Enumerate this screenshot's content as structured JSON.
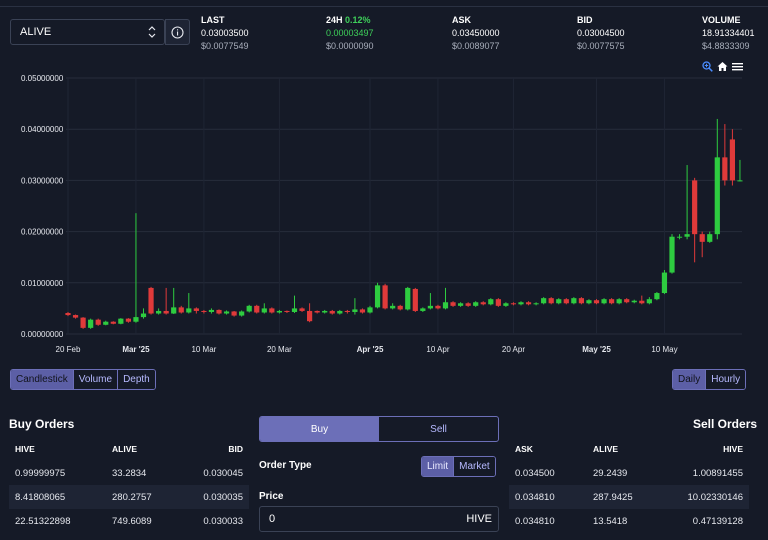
{
  "token": {
    "symbol": "ALIVE"
  },
  "stats": [
    {
      "label": "LAST",
      "pct": "",
      "value": "0.03003500",
      "usd": "$0.0077549"
    },
    {
      "label": "24H",
      "pct": "0.12%",
      "value": "0.00003497",
      "usd": "$0.0000090"
    },
    {
      "label": "ASK",
      "pct": "",
      "value": "0.03450000",
      "usd": "$0.0089077"
    },
    {
      "label": "BID",
      "pct": "",
      "value": "0.03004500",
      "usd": "$0.0077575"
    },
    {
      "label": "VOLUME",
      "pct": "",
      "value": "18.91334401",
      "usd": "$4.8833309"
    }
  ],
  "chart_toolbar": {
    "zoom": "zoom-in-icon",
    "home": "home-icon",
    "menu": "menu-icon"
  },
  "chart_data": {
    "type": "candlestick",
    "y_ticks": [
      "0.05000000",
      "0.04000000",
      "0.03000000",
      "0.02000000",
      "0.01000000",
      "0.00000000"
    ],
    "ylim": [
      0,
      0.05
    ],
    "x_ticks": [
      "20 Feb",
      "Mar '25",
      "10 Mar",
      "20 Mar",
      "Apr '25",
      "10 Apr",
      "20 Apr",
      "May '25",
      "10 May"
    ],
    "x_tick_bold": [
      false,
      true,
      false,
      false,
      true,
      false,
      false,
      true,
      false
    ],
    "x_tick_days": [
      0,
      9,
      18,
      28,
      40,
      49,
      59,
      70,
      79
    ],
    "colors": {
      "up": "#2ecc40",
      "down": "#e03a3a"
    },
    "candles": [
      [
        0,
        0.0041,
        0.0037,
        0.0043,
        0.0035
      ],
      [
        1,
        0.0037,
        0.0032,
        0.0038,
        0.003
      ],
      [
        2,
        0.0032,
        0.0012,
        0.0033,
        0.001
      ],
      [
        3,
        0.0012,
        0.0028,
        0.003,
        0.001
      ],
      [
        4,
        0.0028,
        0.0018,
        0.003,
        0.0016
      ],
      [
        5,
        0.0018,
        0.0024,
        0.0026,
        0.0017
      ],
      [
        6,
        0.0024,
        0.002,
        0.0025,
        0.0019
      ],
      [
        7,
        0.002,
        0.003,
        0.0031,
        0.0019
      ],
      [
        8,
        0.003,
        0.0024,
        0.0031,
        0.0022
      ],
      [
        9,
        0.0024,
        0.0033,
        0.0236,
        0.0022
      ],
      [
        10,
        0.0033,
        0.004,
        0.005,
        0.003
      ],
      [
        11,
        0.009,
        0.004,
        0.0092,
        0.0038
      ],
      [
        12,
        0.004,
        0.0045,
        0.005,
        0.0038
      ],
      [
        13,
        0.0045,
        0.004,
        0.009,
        0.0038
      ],
      [
        14,
        0.004,
        0.0052,
        0.009,
        0.0039
      ],
      [
        15,
        0.0052,
        0.0042,
        0.0055,
        0.004
      ],
      [
        16,
        0.0042,
        0.005,
        0.008,
        0.004
      ],
      [
        17,
        0.005,
        0.0045,
        0.0052,
        0.004
      ],
      [
        18,
        0.0045,
        0.0043,
        0.0047,
        0.004
      ],
      [
        19,
        0.0043,
        0.0047,
        0.005,
        0.004
      ],
      [
        20,
        0.0047,
        0.004,
        0.0048,
        0.0038
      ],
      [
        21,
        0.004,
        0.0044,
        0.0046,
        0.0038
      ],
      [
        22,
        0.0044,
        0.0036,
        0.0045,
        0.0034
      ],
      [
        23,
        0.0036,
        0.0044,
        0.0046,
        0.0034
      ],
      [
        24,
        0.0044,
        0.0055,
        0.0057,
        0.0042
      ],
      [
        25,
        0.0055,
        0.0042,
        0.0057,
        0.004
      ],
      [
        26,
        0.0042,
        0.005,
        0.006,
        0.004
      ],
      [
        27,
        0.005,
        0.0042,
        0.0052,
        0.004
      ],
      [
        28,
        0.0042,
        0.0045,
        0.0047,
        0.004
      ],
      [
        29,
        0.0045,
        0.0043,
        0.0046,
        0.0041
      ],
      [
        30,
        0.0043,
        0.005,
        0.0075,
        0.0041
      ],
      [
        31,
        0.005,
        0.0045,
        0.0052,
        0.0043
      ],
      [
        32,
        0.0045,
        0.0025,
        0.006,
        0.0023
      ],
      [
        33,
        0.0045,
        0.0042,
        0.0046,
        0.004
      ],
      [
        34,
        0.0042,
        0.0045,
        0.0047,
        0.004
      ],
      [
        35,
        0.0045,
        0.004,
        0.0047,
        0.0038
      ],
      [
        36,
        0.004,
        0.0045,
        0.0047,
        0.0038
      ],
      [
        37,
        0.0045,
        0.0043,
        0.0047,
        0.004
      ],
      [
        38,
        0.0043,
        0.0048,
        0.007,
        0.0038
      ],
      [
        39,
        0.0048,
        0.0042,
        0.005,
        0.004
      ],
      [
        40,
        0.0042,
        0.0052,
        0.0055,
        0.004
      ],
      [
        41,
        0.0052,
        0.0095,
        0.01,
        0.005
      ],
      [
        42,
        0.0095,
        0.005,
        0.0098,
        0.0048
      ],
      [
        43,
        0.005,
        0.0055,
        0.006,
        0.0048
      ],
      [
        44,
        0.0055,
        0.0048,
        0.0057,
        0.0046
      ],
      [
        45,
        0.0048,
        0.009,
        0.0092,
        0.0046
      ],
      [
        46,
        0.0088,
        0.0045,
        0.009,
        0.0043
      ],
      [
        47,
        0.0045,
        0.005,
        0.0052,
        0.0043
      ],
      [
        48,
        0.005,
        0.0055,
        0.008,
        0.0048
      ],
      [
        49,
        0.0055,
        0.005,
        0.0057,
        0.0048
      ],
      [
        50,
        0.005,
        0.0062,
        0.009,
        0.0048
      ],
      [
        51,
        0.0062,
        0.0055,
        0.0064,
        0.0053
      ],
      [
        52,
        0.0055,
        0.006,
        0.0062,
        0.0053
      ],
      [
        53,
        0.006,
        0.0055,
        0.0062,
        0.0053
      ],
      [
        54,
        0.0055,
        0.0062,
        0.0064,
        0.0053
      ],
      [
        55,
        0.0062,
        0.0058,
        0.0064,
        0.0056
      ],
      [
        56,
        0.0058,
        0.0068,
        0.007,
        0.0056
      ],
      [
        57,
        0.0068,
        0.0055,
        0.007,
        0.0053
      ],
      [
        58,
        0.0055,
        0.006,
        0.0062,
        0.0053
      ],
      [
        59,
        0.006,
        0.0058,
        0.0062,
        0.0056
      ],
      [
        60,
        0.0058,
        0.0062,
        0.0064,
        0.0056
      ],
      [
        61,
        0.0062,
        0.0058,
        0.0064,
        0.0056
      ],
      [
        62,
        0.0058,
        0.006,
        0.0062,
        0.0056
      ],
      [
        63,
        0.006,
        0.007,
        0.0072,
        0.0058
      ],
      [
        64,
        0.007,
        0.006,
        0.0072,
        0.0058
      ],
      [
        65,
        0.006,
        0.0068,
        0.007,
        0.0058
      ],
      [
        66,
        0.0068,
        0.006,
        0.007,
        0.0058
      ],
      [
        67,
        0.006,
        0.007,
        0.0072,
        0.0058
      ],
      [
        68,
        0.007,
        0.006,
        0.0072,
        0.0058
      ],
      [
        69,
        0.006,
        0.0066,
        0.0068,
        0.0058
      ],
      [
        70,
        0.0066,
        0.006,
        0.0068,
        0.0058
      ],
      [
        71,
        0.006,
        0.0068,
        0.007,
        0.0058
      ],
      [
        72,
        0.0068,
        0.006,
        0.007,
        0.0058
      ],
      [
        73,
        0.006,
        0.0068,
        0.007,
        0.0058
      ],
      [
        74,
        0.0068,
        0.0062,
        0.007,
        0.006
      ],
      [
        75,
        0.0062,
        0.0065,
        0.0067,
        0.006
      ],
      [
        76,
        0.0065,
        0.006,
        0.0075,
        0.0058
      ],
      [
        77,
        0.006,
        0.0068,
        0.0072,
        0.0058
      ],
      [
        78,
        0.0068,
        0.008,
        0.0082,
        0.0066
      ],
      [
        79,
        0.008,
        0.012,
        0.0125,
        0.0078
      ],
      [
        80,
        0.012,
        0.019,
        0.0195,
        0.0118
      ],
      [
        81,
        0.019,
        0.019,
        0.0195,
        0.0185
      ],
      [
        82,
        0.019,
        0.0195,
        0.033,
        0.0185
      ],
      [
        83,
        0.03,
        0.0195,
        0.0305,
        0.014
      ],
      [
        84,
        0.0195,
        0.018,
        0.02,
        0.015
      ],
      [
        85,
        0.018,
        0.0195,
        0.02,
        0.0178
      ],
      [
        86,
        0.0195,
        0.0345,
        0.042,
        0.0185
      ],
      [
        87,
        0.0345,
        0.03,
        0.041,
        0.029
      ],
      [
        88,
        0.038,
        0.03,
        0.04,
        0.029
      ],
      [
        89,
        0.03,
        0.03,
        0.034,
        0.0298
      ]
    ]
  },
  "chart_type_buttons": [
    "Candlestick",
    "Volume",
    "Depth"
  ],
  "interval_buttons": [
    "Daily",
    "Hourly"
  ],
  "buy_orders": {
    "title": "Buy Orders",
    "headers": [
      "HIVE",
      "ALIVE",
      "BID"
    ],
    "rows": [
      [
        "0.99999975",
        "33.2834",
        "0.030045"
      ],
      [
        "8.41808065",
        "280.2757",
        "0.030035"
      ],
      [
        "22.51322898",
        "749.6089",
        "0.030033"
      ]
    ]
  },
  "sell_orders": {
    "title": "Sell Orders",
    "headers": [
      "ASK",
      "ALIVE",
      "HIVE"
    ],
    "rows": [
      [
        "0.034500",
        "29.2439",
        "1.00891455"
      ],
      [
        "0.034810",
        "287.9425",
        "10.02330146"
      ],
      [
        "0.034810",
        "13.5418",
        "0.47139128"
      ]
    ]
  },
  "order_form": {
    "buy_label": "Buy",
    "sell_label": "Sell",
    "order_type_label": "Order Type",
    "order_types": [
      "Limit",
      "Market"
    ],
    "price_label": "Price",
    "price_value": "0",
    "price_unit": "HIVE"
  }
}
